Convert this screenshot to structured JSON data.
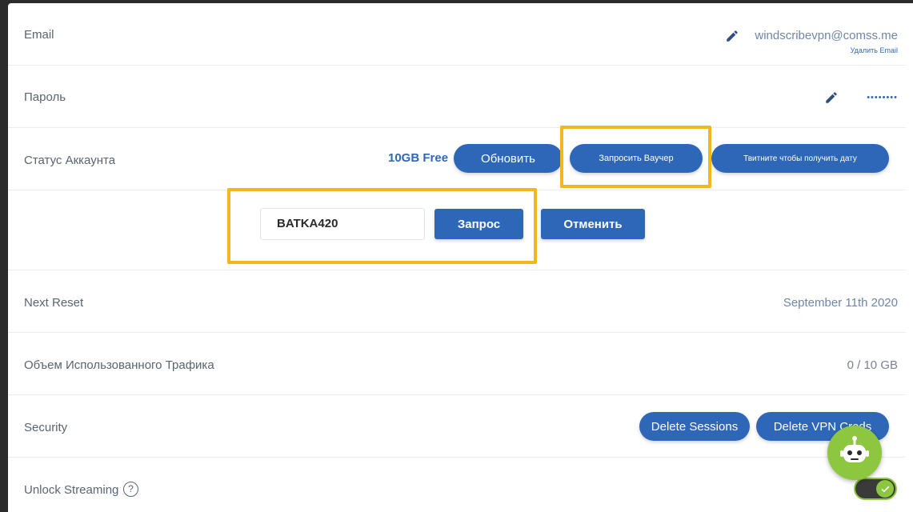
{
  "email": {
    "label": "Email",
    "value": "windscribevpn@comss.me",
    "delete_link": "Удалить Email"
  },
  "password": {
    "label": "Пароль",
    "value": "••••••••"
  },
  "account_status": {
    "label": "Статус Аккаунта",
    "plan": "10GB Free",
    "upgrade_button": "Обновить",
    "voucher_button": "Запросить Ваучер",
    "tweet_button": "Твитните чтобы получить дату"
  },
  "voucher": {
    "input_value": "BATKA420",
    "submit_button": "Запрос",
    "cancel_button": "Отменить"
  },
  "next_reset": {
    "label": "Next Reset",
    "value": "September 11th 2020"
  },
  "traffic": {
    "label": "Объем Использованного Трафика",
    "value": "0 / 10 GB"
  },
  "security": {
    "label": "Security",
    "delete_sessions_button": "Delete Sessions",
    "delete_creds_button": "Delete VPN Creds"
  },
  "streaming": {
    "label": "Unlock Streaming",
    "help_glyph": "?",
    "enabled": true
  },
  "colors": {
    "accent": "#2f67b8",
    "highlight": "#f0b81c",
    "bot": "#8dc63f"
  }
}
